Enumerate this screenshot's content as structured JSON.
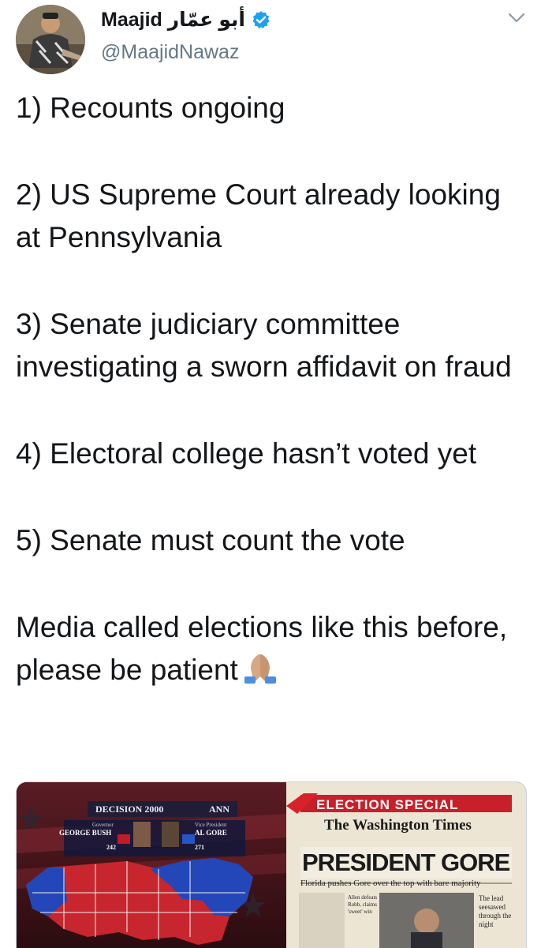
{
  "author": {
    "name_latin": "Maajid",
    "name_arabic": "أبو عمّار",
    "handle": "@MaajidNawaz",
    "verified": true,
    "verified_color": "#1da1f2"
  },
  "tweet": {
    "paragraphs": [
      "1) Recounts ongoing",
      "2) US Supreme Court already looking at Pennsylvania",
      "3) Senate judiciary committee investigating a sworn affidavit on fraud",
      "4) Electoral college hasn’t voted yet",
      "5) Senate must count the vote",
      "Media called elections like this before, please be patient"
    ],
    "emoji": "folded-hands-emoji"
  },
  "media": {
    "left": {
      "decision_title": "DECISION 2000",
      "network": "ANN",
      "left_role": "Governor",
      "left_candidate": "GEORGE BUSH",
      "left_votes": "242",
      "right_role": "Vice President",
      "right_candidate": "AL GORE",
      "right_votes": "271"
    },
    "right": {
      "banner": "ELECTION SPECIAL",
      "masthead": "The Washington Times",
      "headline": "PRESIDENT GORE",
      "subhead": "Florida pushes Gore over the top with bare majority",
      "col1": "Allen defeats Robb, claims 'sweet' win",
      "col2": "The lead seesawed through the night"
    }
  }
}
